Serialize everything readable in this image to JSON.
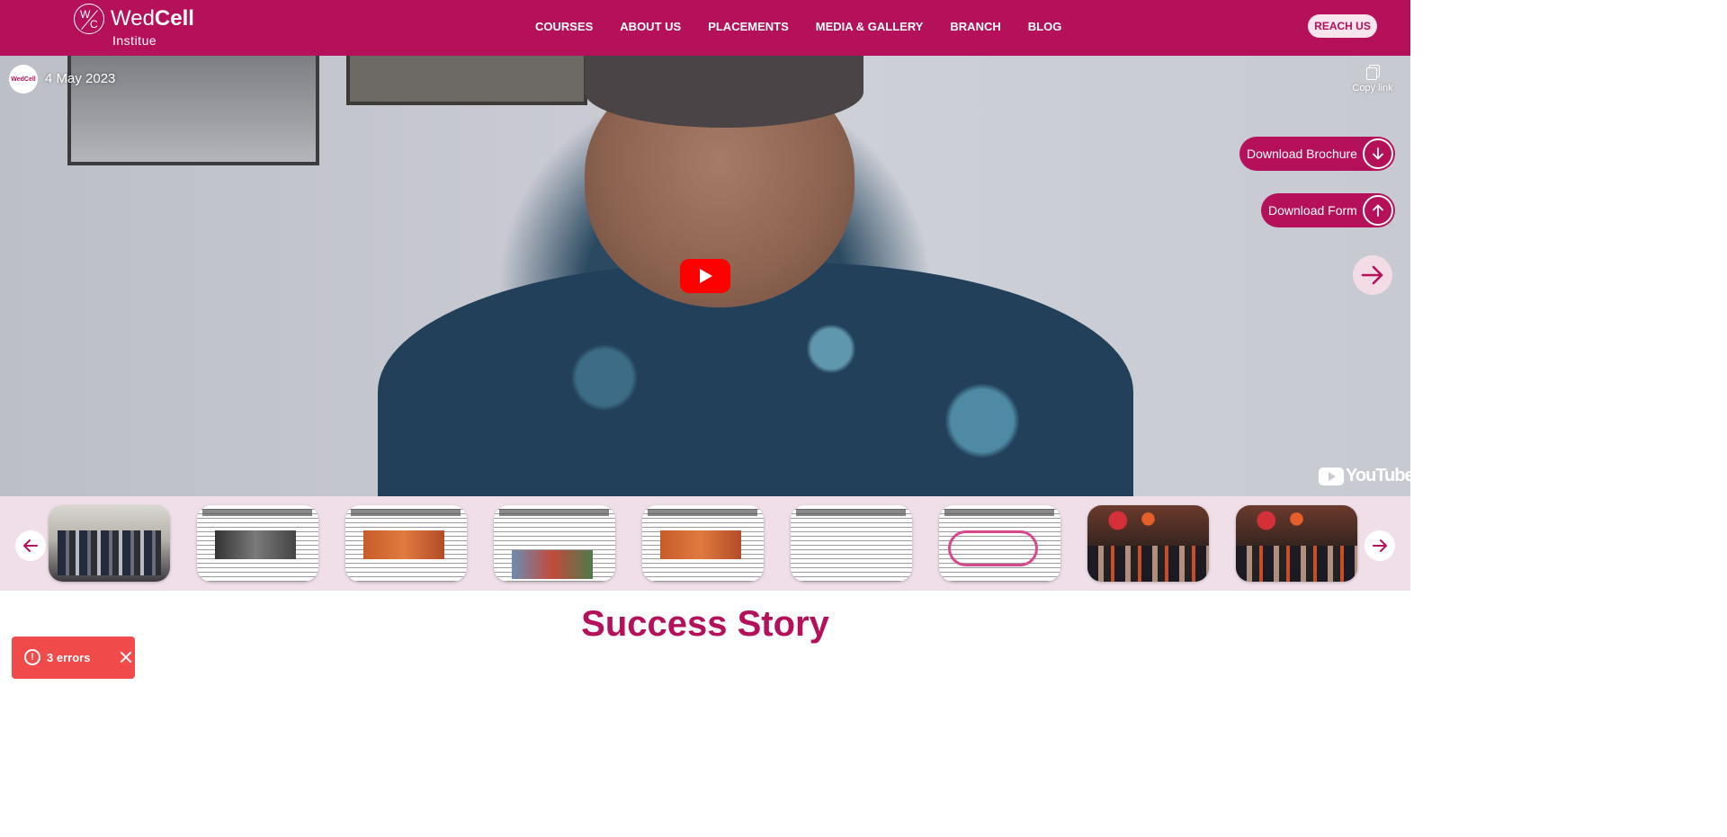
{
  "brand": {
    "logo_mark_w": "W",
    "logo_mark_c": "C",
    "name_regular": "Wed",
    "name_bold": "Cell",
    "subtitle": "Institue",
    "color": "#b5105a"
  },
  "nav": {
    "items": [
      "COURSES",
      "ABOUT US",
      "PLACEMENTS",
      "MEDIA & GALLERY",
      "BRANCH",
      "BLOG"
    ],
    "cta": "REACH US"
  },
  "video": {
    "channel_avatar": "WedCell",
    "date": "4 May 2023",
    "copy_link": "Copy link",
    "platform": "YouTube",
    "play_icon": "play-icon"
  },
  "actions": {
    "brochure": "Download Brochure",
    "form": "Download Form"
  },
  "gallery": {
    "thumbnails": [
      {
        "type": "photo",
        "name": "gallery-thumb-group-photo"
      },
      {
        "type": "news",
        "name": "gallery-thumb-news-1"
      },
      {
        "type": "news",
        "name": "gallery-thumb-news-2"
      },
      {
        "type": "news",
        "name": "gallery-thumb-news-3"
      },
      {
        "type": "news",
        "name": "gallery-thumb-news-4"
      },
      {
        "type": "news",
        "name": "gallery-thumb-news-5"
      },
      {
        "type": "news",
        "name": "gallery-thumb-news-6"
      },
      {
        "type": "party",
        "name": "gallery-thumb-event-1"
      },
      {
        "type": "party",
        "name": "gallery-thumb-event-2"
      }
    ]
  },
  "section": {
    "title": "Success Story"
  },
  "toast": {
    "text": "3 errors",
    "icon": "!"
  }
}
